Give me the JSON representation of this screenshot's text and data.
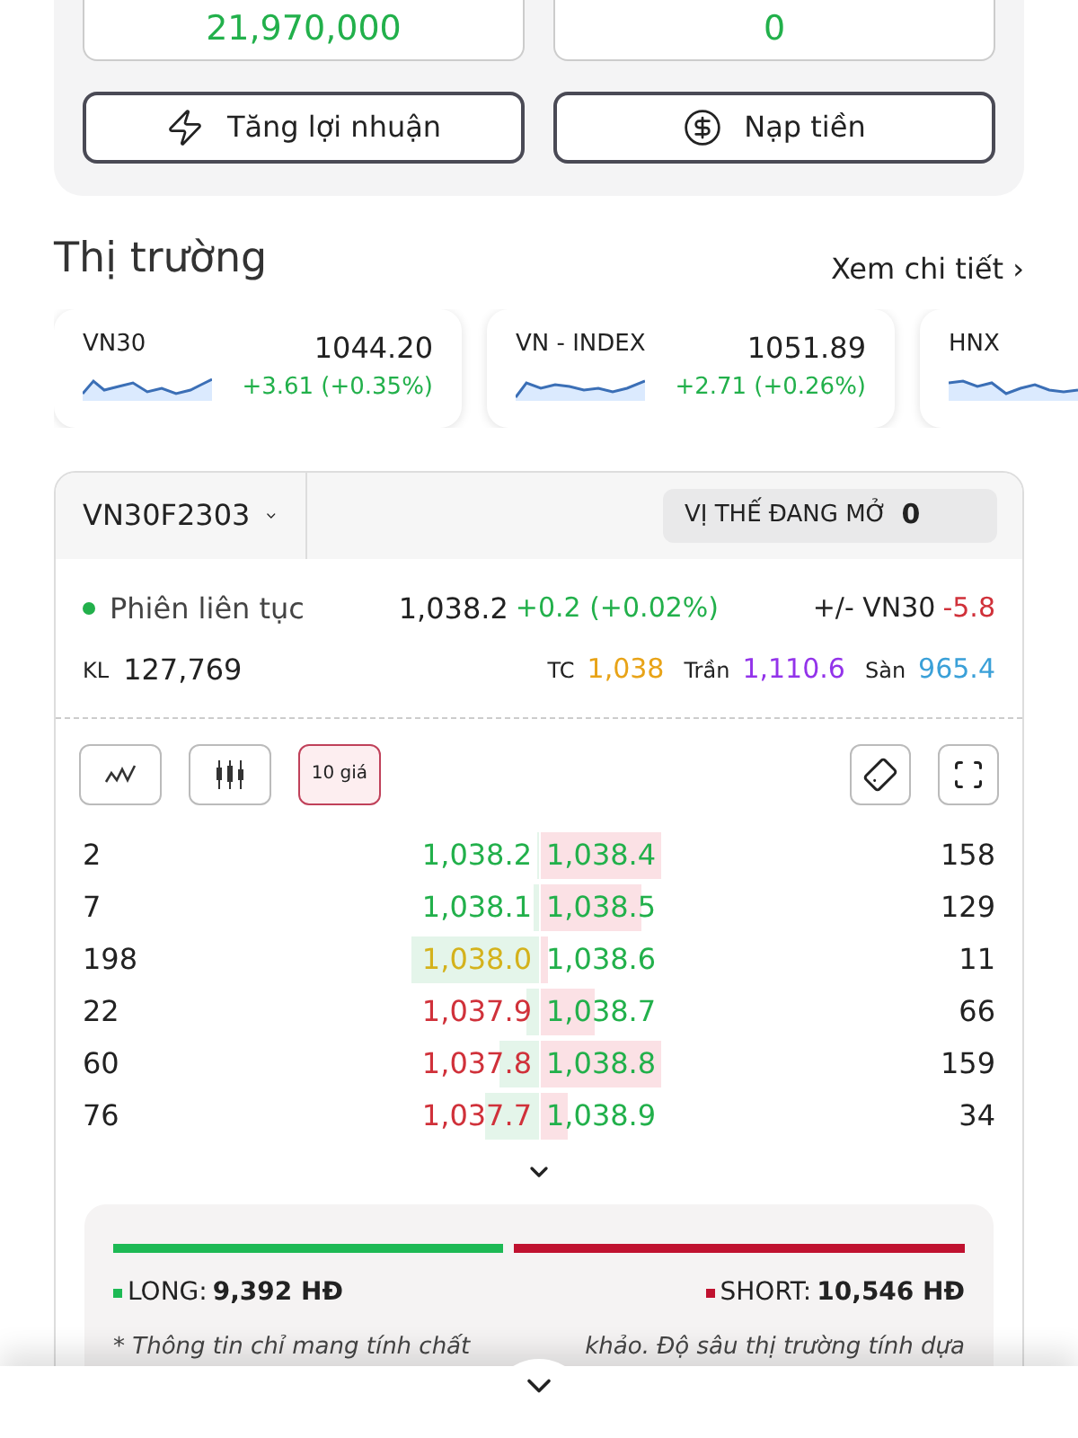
{
  "balances": [
    {
      "value": "21,970,000"
    },
    {
      "value": "0"
    }
  ],
  "actions": [
    {
      "label": "Tăng lợi nhuận",
      "kind": "bolt"
    },
    {
      "label": "Nạp tiền",
      "kind": "dollar"
    }
  ],
  "market": {
    "title": "Thị trường",
    "link": "Xem chi tiết",
    "link_icon": "›"
  },
  "indices": [
    {
      "name": "VN30",
      "value": "1044.20",
      "change": "+3.61 (+0.35%)"
    },
    {
      "name": "VN - INDEX",
      "value": "1051.89",
      "change": "+2.71 (+0.26%)"
    },
    {
      "name": "HNX"
    }
  ],
  "contract": {
    "symbol": "VN30F2303",
    "open_label": "VỊ THẾ ĐANG MỞ",
    "open_value": "0"
  },
  "session": {
    "status": "Phiên liên tục",
    "price": "1,038.2",
    "change": "+0.2 (+0.02%)",
    "basis_label": "+/- VN30",
    "basis": "-5.8",
    "volume_label": "KL",
    "volume": "127,769",
    "ref_label": "TC",
    "ref": "1,038",
    "ceil_label": "Trần",
    "ceil": "1,110.6",
    "floor_label": "Sàn",
    "floor": "965.4"
  },
  "tools": [
    {
      "kind": "line",
      "selected": false
    },
    {
      "kind": "candle",
      "selected": false
    },
    {
      "kind": "text",
      "label": "10 giá",
      "selected": true
    }
  ],
  "order_book": [
    {
      "bid": {
        "volume": "2",
        "price": "1,038.2",
        "color": "#22b04b",
        "level": 0.02
      },
      "ask": {
        "price": "1,038.4",
        "color": "#22b04b",
        "level": 0.9,
        "volume": "158"
      }
    },
    {
      "bid": {
        "volume": "7",
        "price": "1,038.1",
        "color": "#22b04b",
        "level": 0.04
      },
      "ask": {
        "price": "1,038.5",
        "color": "#22b04b",
        "level": 0.75,
        "volume": "129"
      }
    },
    {
      "bid": {
        "volume": "198",
        "price": "1,038.0",
        "color": "#d4b21c",
        "level": 0.95
      },
      "ask": {
        "price": "1,038.6",
        "color": "#22b04b",
        "level": 0.05,
        "volume": "11"
      }
    },
    {
      "bid": {
        "volume": "22",
        "price": "1,037.9",
        "color": "#d0313a",
        "level": 0.1
      },
      "ask": {
        "price": "1,038.7",
        "color": "#22b04b",
        "level": 0.4,
        "volume": "66"
      }
    },
    {
      "bid": {
        "volume": "60",
        "price": "1,037.8",
        "color": "#d0313a",
        "level": 0.3
      },
      "ask": {
        "price": "1,038.8",
        "color": "#22b04b",
        "level": 0.9,
        "volume": "159"
      }
    },
    {
      "bid": {
        "volume": "76",
        "price": "1,037.7",
        "color": "#d0313a",
        "level": 0.4
      },
      "ask": {
        "price": "1,038.9",
        "color": "#22b04b",
        "level": 0.2,
        "volume": "34"
      }
    }
  ],
  "long_short": {
    "level": 0.47,
    "long_label": "LONG:",
    "long_value": "9,392 HĐ",
    "short_label": "SHORT:",
    "short_value": "10,546 HĐ"
  },
  "disclaimer": {
    "left": "* Thông tin chỉ mang tính chất",
    "right": "khảo. Độ sâu thị trường tính dựa"
  }
}
